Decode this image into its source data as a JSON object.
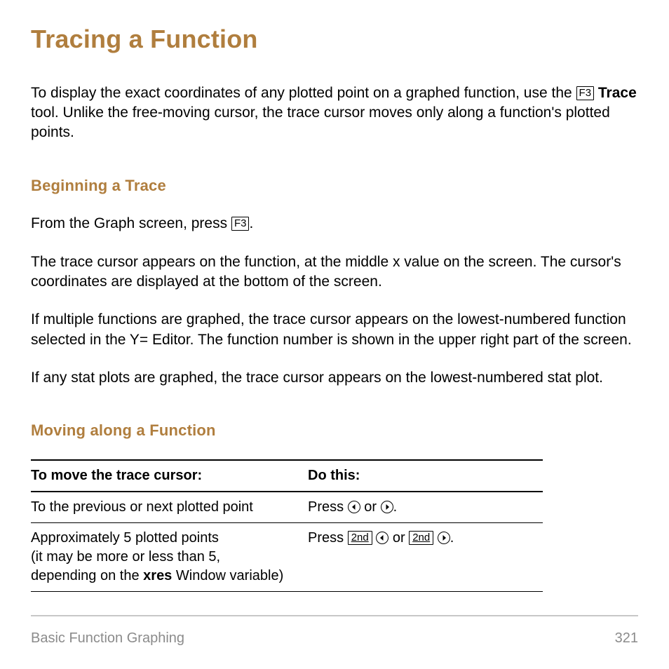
{
  "title": "Tracing a Function",
  "intro": {
    "pre_key": "To display the exact coordinates of any plotted point on a graphed function, use the ",
    "key": "F3",
    "after_key_bold": "Trace",
    "rest": " tool. Unlike the free-moving cursor, the trace cursor moves only along a function's plotted points."
  },
  "section1": {
    "heading": "Beginning a Trace",
    "p1_pre": "From the Graph screen, press ",
    "p1_key": "F3",
    "p1_post": ".",
    "p2": "The trace cursor appears on the function, at the middle x value on the screen. The cursor's coordinates are displayed at the bottom of the screen.",
    "p3": "If multiple functions are graphed, the trace cursor appears on the lowest-numbered function selected in the Y= Editor. The function number is shown in the upper right part of the screen.",
    "p4": "If any stat plots are graphed, the trace cursor appears on the lowest-numbered stat plot."
  },
  "section2": {
    "heading": "Moving along a Function",
    "th1": "To move the trace cursor:",
    "th2": "Do this:",
    "row1": {
      "c1": "To the previous or next plotted point",
      "c2_press": "Press ",
      "c2_or": " or ",
      "c2_end": "."
    },
    "row2": {
      "c1_l1": "Approximately 5 plotted points",
      "c1_l2": "(it may be more or less than 5,",
      "c1_l3_pre": "depending on the ",
      "c1_l3_bold": "xres",
      "c1_l3_post": " Window variable)",
      "c2_press": "Press ",
      "c2_key": "2nd",
      "c2_or": " or ",
      "c2_end": "."
    }
  },
  "footer": {
    "left": "Basic Function Graphing",
    "right": "321"
  }
}
